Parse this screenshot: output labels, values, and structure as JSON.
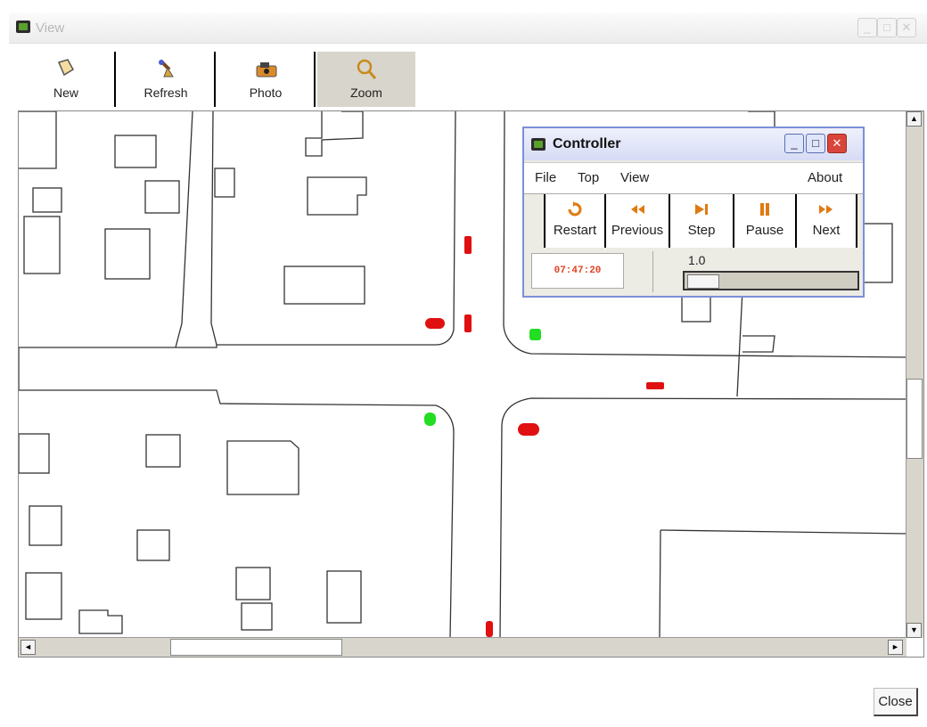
{
  "window": {
    "title": "View"
  },
  "toolbar": {
    "items": [
      {
        "label": "New",
        "icon": "new-document-icon"
      },
      {
        "label": "Refresh",
        "icon": "refresh-icon"
      },
      {
        "label": "Photo",
        "icon": "camera-icon"
      },
      {
        "label": "Zoom",
        "icon": "magnifier-icon"
      }
    ]
  },
  "controller": {
    "title": "Controller",
    "menu": {
      "file": "File",
      "top": "Top",
      "view": "View",
      "about": "About"
    },
    "buttons": [
      {
        "label": "Restart",
        "icon": "restart-icon"
      },
      {
        "label": "Previous",
        "icon": "rewind-icon"
      },
      {
        "label": "Step",
        "icon": "step-icon"
      },
      {
        "label": "Pause",
        "icon": "pause-icon"
      },
      {
        "label": "Next",
        "icon": "fast-forward-icon"
      }
    ],
    "time": "07:47:20",
    "speed": "1.0"
  },
  "close_label": "Close",
  "colors": {
    "vehicle": "#e01010",
    "signal_green": "#22dd22",
    "highlight": "#e0421f"
  }
}
